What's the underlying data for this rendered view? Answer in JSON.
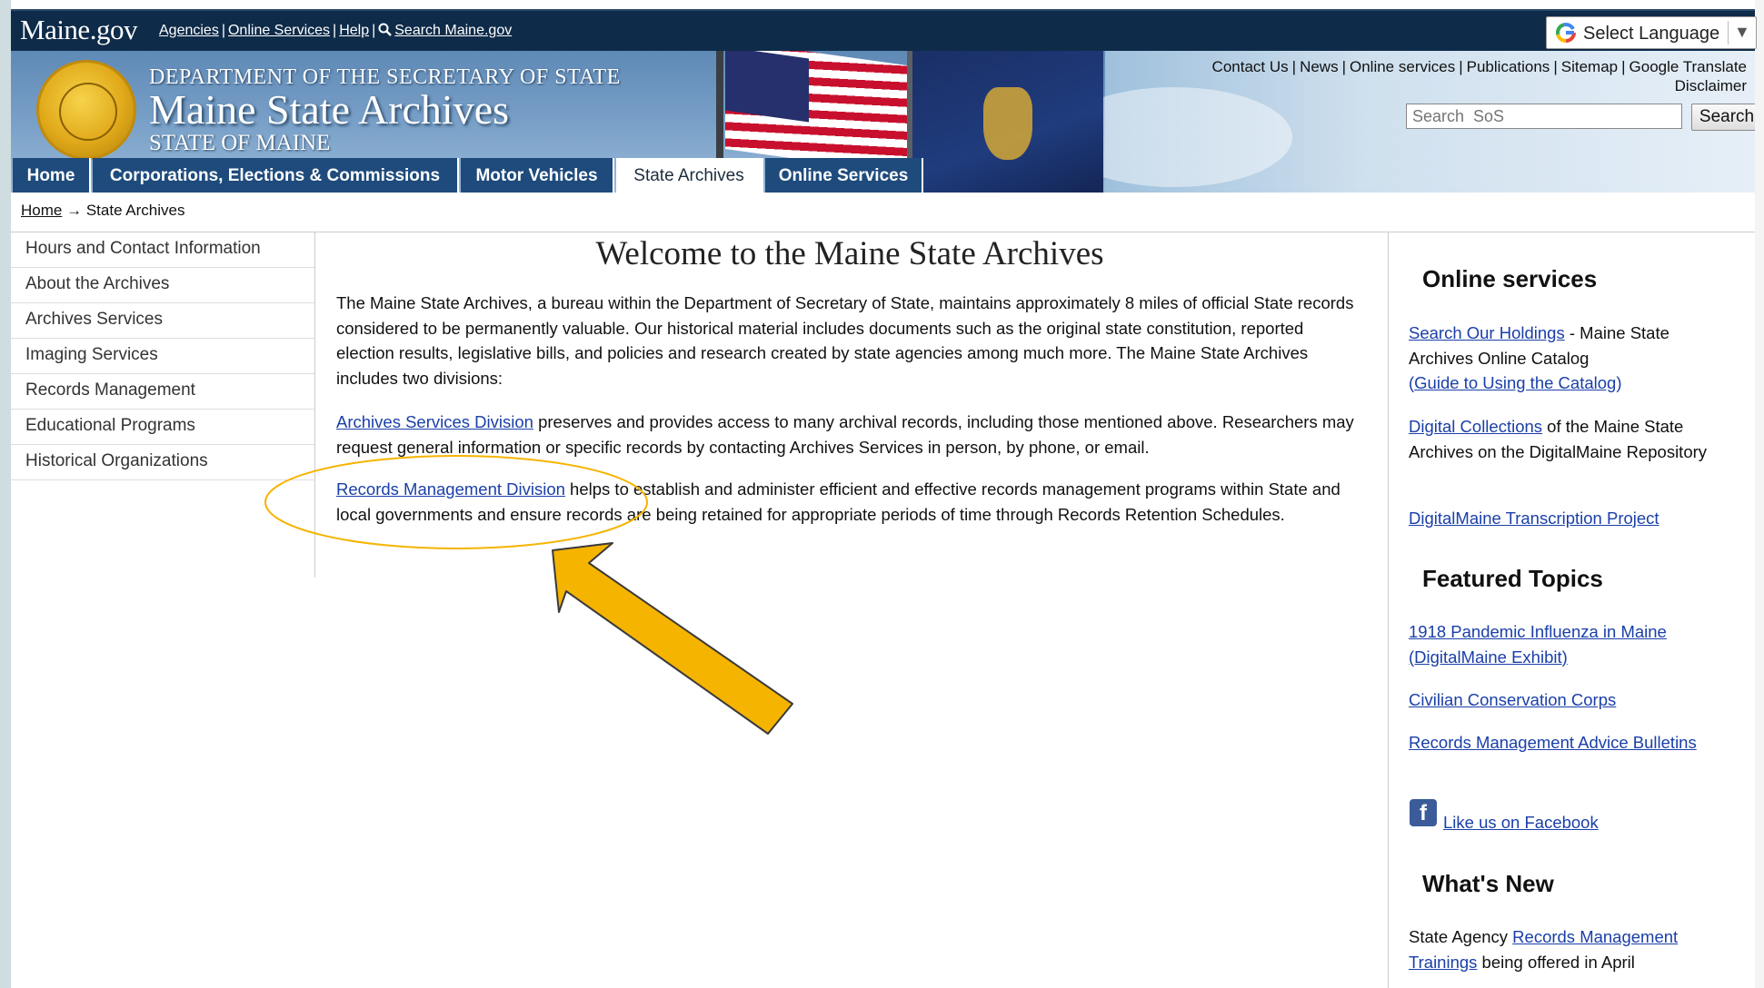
{
  "topbar": {
    "logo": "Maine.gov",
    "links": [
      "Agencies",
      "Online Services",
      "Help"
    ],
    "search_link": "Search Maine.gov",
    "language": "Select Language"
  },
  "banner": {
    "dept": "DEPARTMENT OF THE SECRETARY OF STATE",
    "title": "Maine State Archives",
    "state": "STATE OF MAINE",
    "util_links": [
      "Contact Us",
      "News",
      "Online services",
      "Publications",
      "Sitemap",
      "Google Translate"
    ],
    "disclaimer": "Disclaimer",
    "search_placeholder": "Search  SoS",
    "search_button": "Search"
  },
  "tabs": [
    {
      "label": "Home"
    },
    {
      "label": "Corporations, Elections & Commissions"
    },
    {
      "label": "Motor Vehicles"
    },
    {
      "label": "State Archives"
    },
    {
      "label": "Online Services"
    }
  ],
  "breadcrumb": {
    "home": "Home",
    "sep": "→",
    "current": "State Archives"
  },
  "sidebar": [
    "Hours and Contact Information",
    "About the Archives",
    "Archives Services",
    "Imaging Services",
    "Records Management",
    "Educational Programs",
    "Historical Organizations"
  ],
  "main": {
    "title": "Welcome to the Maine State Archives",
    "intro": "The Maine State Archives, a bureau within the Department of Secretary of State, maintains approximately 8 miles of official State records considered to be permanently valuable. Our historical material includes documents such as the original state constitution, reported election results, legislative bills, and policies and research created by state agencies among much more. The Maine State Archives includes two divisions:",
    "archives_link": "Archives Services Division",
    "archives_text": " preserves and provides access to many archival records, including those mentioned above. Researchers may request general information or specific records by contacting Archives Services in person, by phone, or email.",
    "records_link": "Records Management Division",
    "records_text": " helps to establish and administer efficient and effective records management programs within State and local governments and ensure records are being retained for appropriate periods of time through Records Retention Schedules."
  },
  "right": {
    "online_head": "Online services",
    "holdings_link": "Search Our Holdings",
    "holdings_text": " - Maine State Archives Online Catalog",
    "guide_open": "(",
    "guide_link": "Guide to Using the Catalog",
    "guide_close": ")",
    "digital_link": "Digital Collections",
    "digital_text": " of the Maine State Archives on the DigitalMaine Repository",
    "transcription_link": "DigitalMaine Transcription Project",
    "featured_head": "Featured Topics",
    "featured": [
      "1918 Pandemic Influenza in Maine (DigitalMaine Exhibit)",
      "Civilian Conservation Corps",
      "Records Management Advice Bulletins"
    ],
    "facebook_link": "Like us on Facebook",
    "new_head": "What's New",
    "new_prefix": "State Agency ",
    "new_link": "Records Management Trainings",
    "new_suffix": " being offered in April"
  },
  "colors": {
    "nav_tab": "#1e4b7c",
    "topbar": "#0e2b49",
    "link": "#1a3fa8",
    "annotation_arrow": "#f5b400"
  }
}
